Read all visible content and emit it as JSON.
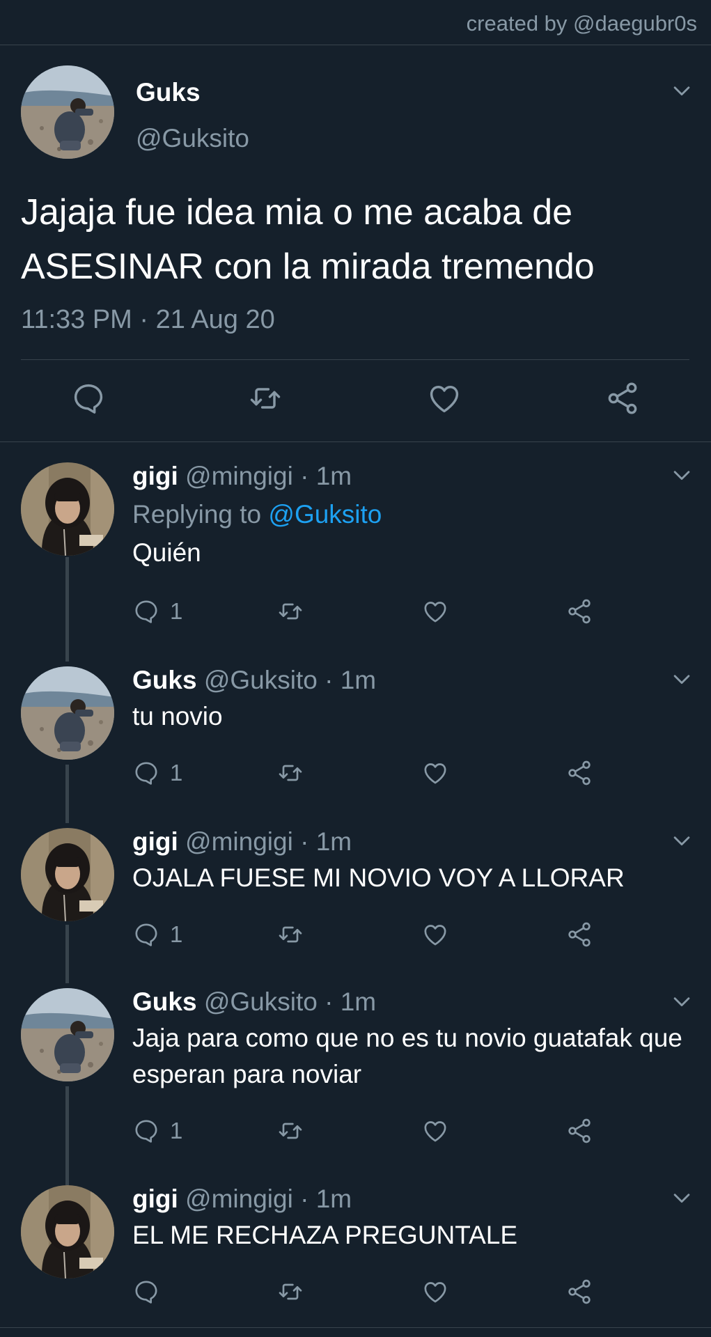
{
  "credit": "created by @daegubr0s",
  "colors": {
    "background": "#15202b",
    "text": "#ffffff",
    "secondary": "#8899a6",
    "divider": "#38444d",
    "link": "#1da1f2"
  },
  "main_tweet": {
    "name": "Guks",
    "handle": "@Guksito",
    "text": "Jajaja fue idea mia o me acaba de ASESINAR con la mirada tremendo",
    "timestamp": "11:33 PM · 21 Aug 20",
    "actions": [
      "reply-icon",
      "retweet-icon",
      "like-icon",
      "share-icon"
    ]
  },
  "replies": [
    {
      "name": "gigi",
      "handle": "@mingigi",
      "time": "· 1m",
      "replying_label": "Replying to",
      "replying_to": "@Guksito",
      "text": "Quién",
      "reply_count": "1",
      "avatar": "gigi-avatar"
    },
    {
      "name": "Guks",
      "handle": "@Guksito",
      "time": "· 1m",
      "text": "tu novio",
      "reply_count": "1",
      "avatar": "guks-avatar"
    },
    {
      "name": "gigi",
      "handle": "@mingigi",
      "time": "· 1m",
      "text": "OJALA FUESE MI NOVIO VOY A LLORAR",
      "reply_count": "1",
      "avatar": "gigi-avatar"
    },
    {
      "name": "Guks",
      "handle": "@Guksito",
      "time": "· 1m",
      "text": "Jaja para como que no es tu novio guatafak que esperan para noviar",
      "reply_count": "1",
      "avatar": "guks-avatar"
    },
    {
      "name": "gigi",
      "handle": "@mingigi",
      "time": "· 1m",
      "text": "EL ME RECHAZA PREGUNTALE",
      "reply_count": "",
      "avatar": "gigi-avatar"
    }
  ]
}
